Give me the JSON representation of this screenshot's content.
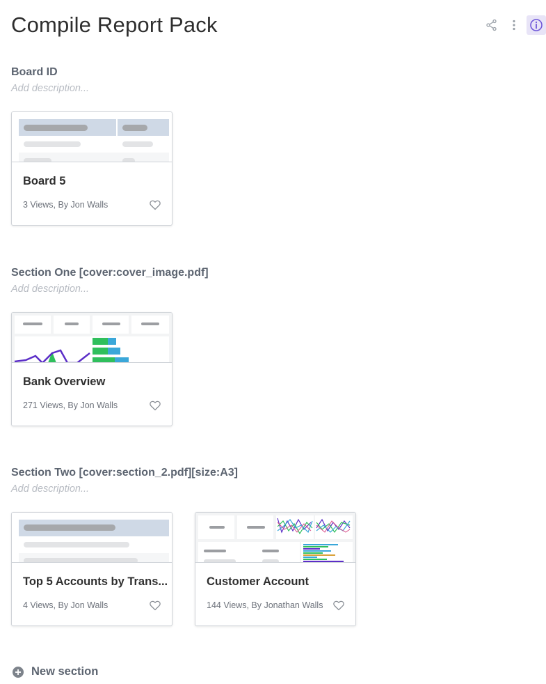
{
  "header": {
    "title": "Compile Report Pack",
    "actions": [
      {
        "name": "share",
        "icon": "share-icon"
      },
      {
        "name": "more",
        "icon": "more-vertical-icon"
      },
      {
        "name": "info",
        "icon": "info-icon"
      }
    ]
  },
  "colors": {
    "accent": "#6f57d9",
    "info_bg": "#e8e4f7",
    "chart_purple": "#5b2ec7",
    "chart_green": "#2fbf5c",
    "chart_blue": "#3aa7d9"
  },
  "sections": [
    {
      "title": "Board ID",
      "description_placeholder": "Add description...",
      "cards": [
        {
          "title": "Board 5",
          "meta": "3 Views, By Jon Walls",
          "thumbnail": "table"
        }
      ]
    },
    {
      "title": "Section One [cover:cover_image.pdf]",
      "description_placeholder": "Add description...",
      "cards": [
        {
          "title": "Bank Overview",
          "meta": "271 Views, By Jon Walls",
          "thumbnail": "dashboard"
        }
      ]
    },
    {
      "title": "Section Two [cover:section_2.pdf][size:A3]",
      "description_placeholder": "Add description...",
      "cards": [
        {
          "title": "Top 5 Accounts by Trans...",
          "meta": "4 Views, By Jon Walls",
          "thumbnail": "table-wide"
        },
        {
          "title": "Customer Account",
          "meta": "144 Views, By Jonathan Walls",
          "thumbnail": "dashboard-lines"
        }
      ]
    }
  ],
  "footer": {
    "new_section_label": "New section",
    "icon": "plus-circle-icon"
  }
}
